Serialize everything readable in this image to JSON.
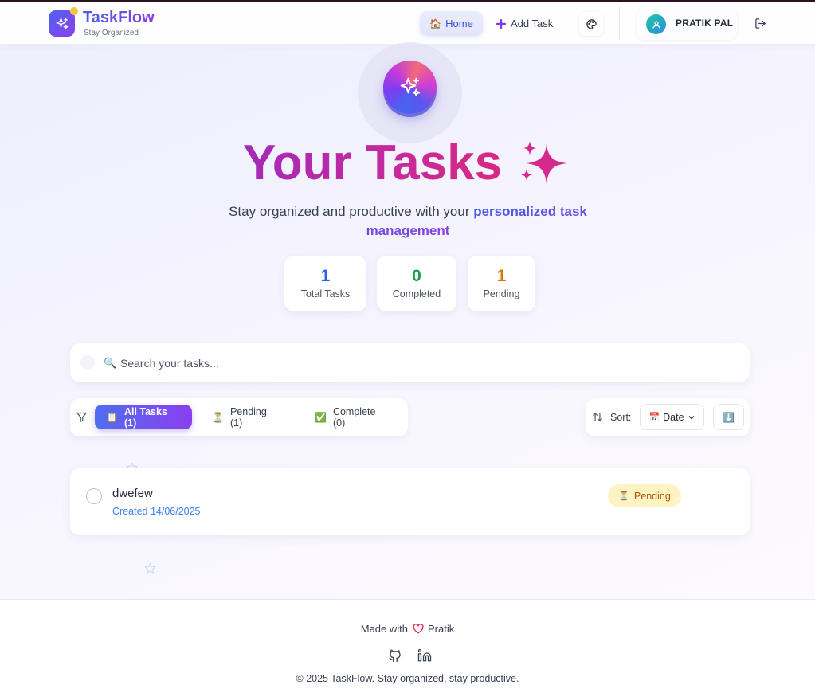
{
  "header": {
    "brand_name": "TaskFlow",
    "brand_tagline": "Stay Organized",
    "nav": {
      "home_label": "Home",
      "home_emoji": "🏠",
      "add_task_label": "Add Task"
    },
    "user_name": "PRATIK PAL"
  },
  "hero": {
    "title": "Your Tasks",
    "subtitle_plain": "Stay organized and productive with your ",
    "subtitle_accent": "personalized task management"
  },
  "stats": [
    {
      "value": "1",
      "label": "Total Tasks",
      "color": "#2563eb"
    },
    {
      "value": "0",
      "label": "Completed",
      "color": "#16a34a"
    },
    {
      "value": "1",
      "label": "Pending",
      "color": "#d97706"
    }
  ],
  "search": {
    "placeholder": "Search your tasks...",
    "icon_emoji": "🔍"
  },
  "filters": {
    "tabs": [
      {
        "emoji": "📋",
        "label": "All Tasks (1)",
        "active": true
      },
      {
        "emoji": "⏳",
        "label": "Pending (1)",
        "active": false
      },
      {
        "emoji": "✅",
        "label": "Complete (0)",
        "active": false
      }
    ]
  },
  "sort": {
    "label": "Sort:",
    "selected": "Date",
    "selected_emoji": "📅",
    "order_emoji": "⬇️"
  },
  "tasks": [
    {
      "title": "dwefew",
      "created": "Created 14/06/2025",
      "status": "Pending",
      "status_emoji": "⏳"
    }
  ],
  "footer": {
    "made_with_prefix": "Made with",
    "made_with_author": "Pratik",
    "copyright": "© 2025 TaskFlow. Stay organized, stay productive."
  },
  "icons": {
    "brand": "sparkles-icon",
    "add": "plus-icon",
    "theme": "palette-icon",
    "user": "user-icon",
    "logout": "logout-icon",
    "filter": "filter-icon",
    "sort": "sort-arrows-icon",
    "heart": "heart-icon",
    "github": "github-icon",
    "linkedin": "linkedin-icon"
  },
  "colors": {
    "accent_start": "#4f6ef0",
    "accent_end": "#8a3ff0",
    "title_magenta": "#c72a9a",
    "pending_bg": "#fdf3c3",
    "pending_text": "#b45309"
  }
}
